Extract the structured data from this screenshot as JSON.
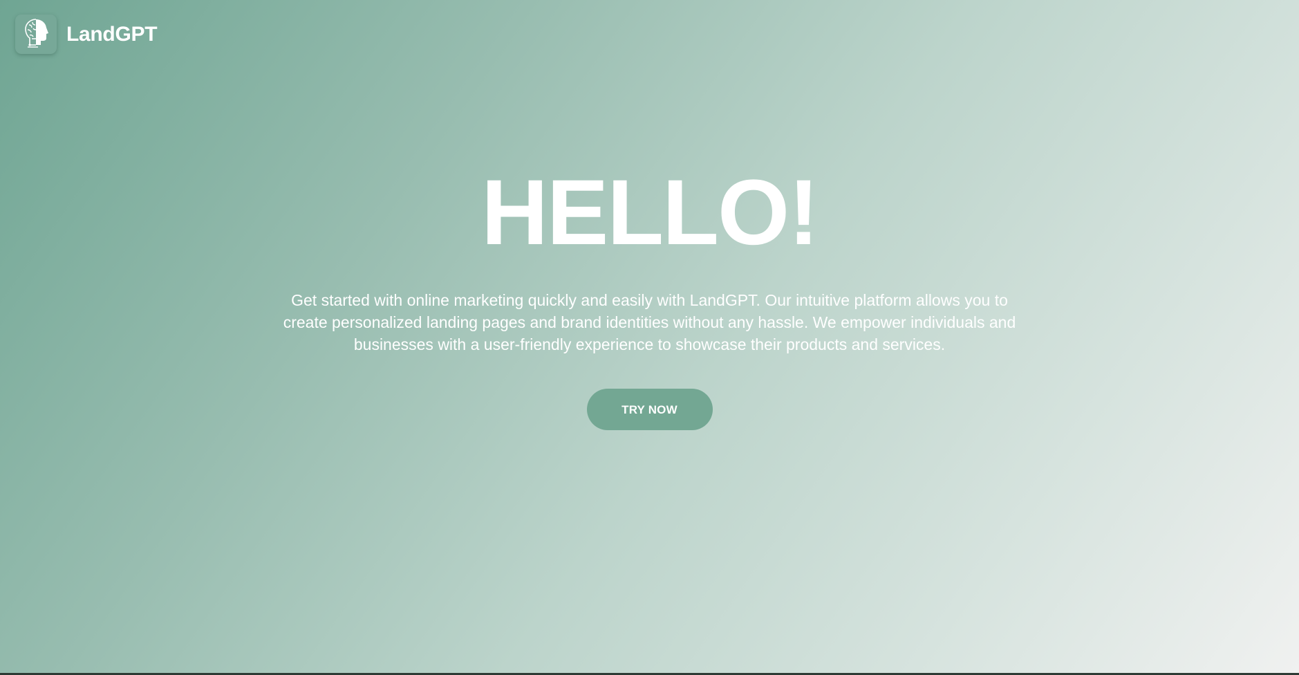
{
  "header": {
    "brand_name": "LandGPT",
    "logo_icon": "brain-head-icon"
  },
  "hero": {
    "title": "HELLO!",
    "description": "Get started with online marketing quickly and easily with LandGPT. Our intuitive platform allows you to create personalized landing pages and brand identities without any hassle. We empower individuals and businesses with a user-friendly experience to showcase their products and services.",
    "cta_label": "TRY NOW"
  },
  "colors": {
    "gradient_start": "#6fa593",
    "gradient_end": "#f0f1f0",
    "button": "#73a793",
    "text": "#ffffff"
  }
}
